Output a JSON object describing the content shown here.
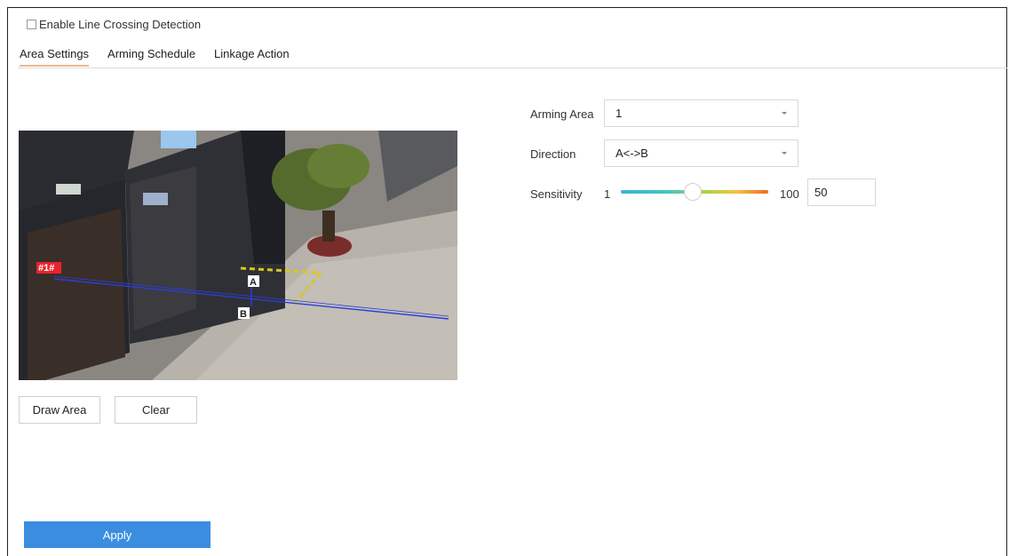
{
  "enable": {
    "label": "Enable Line Crossing Detection",
    "checked": false
  },
  "tabs": [
    {
      "label": "Area Settings",
      "active": true
    },
    {
      "label": "Arming Schedule",
      "active": false
    },
    {
      "label": "Linkage Action",
      "active": false
    }
  ],
  "video": {
    "area_tag": "#1#",
    "point_a": "A",
    "point_b": "B"
  },
  "buttons": {
    "draw_area": "Draw Area",
    "clear": "Clear",
    "apply": "Apply"
  },
  "settings": {
    "arming_area": {
      "label": "Arming Area",
      "value": "1"
    },
    "direction": {
      "label": "Direction",
      "value": "A<->B"
    },
    "sensitivity": {
      "label": "Sensitivity",
      "min": "1",
      "max": "100",
      "value": "50"
    }
  },
  "colors": {
    "apply_button": "#3b8de0",
    "active_tab_underline": "#f0b690",
    "line": "#2a3fd6"
  },
  "icons": {
    "dropdown": "chevron-down-icon",
    "checkbox": "checkbox-icon"
  }
}
